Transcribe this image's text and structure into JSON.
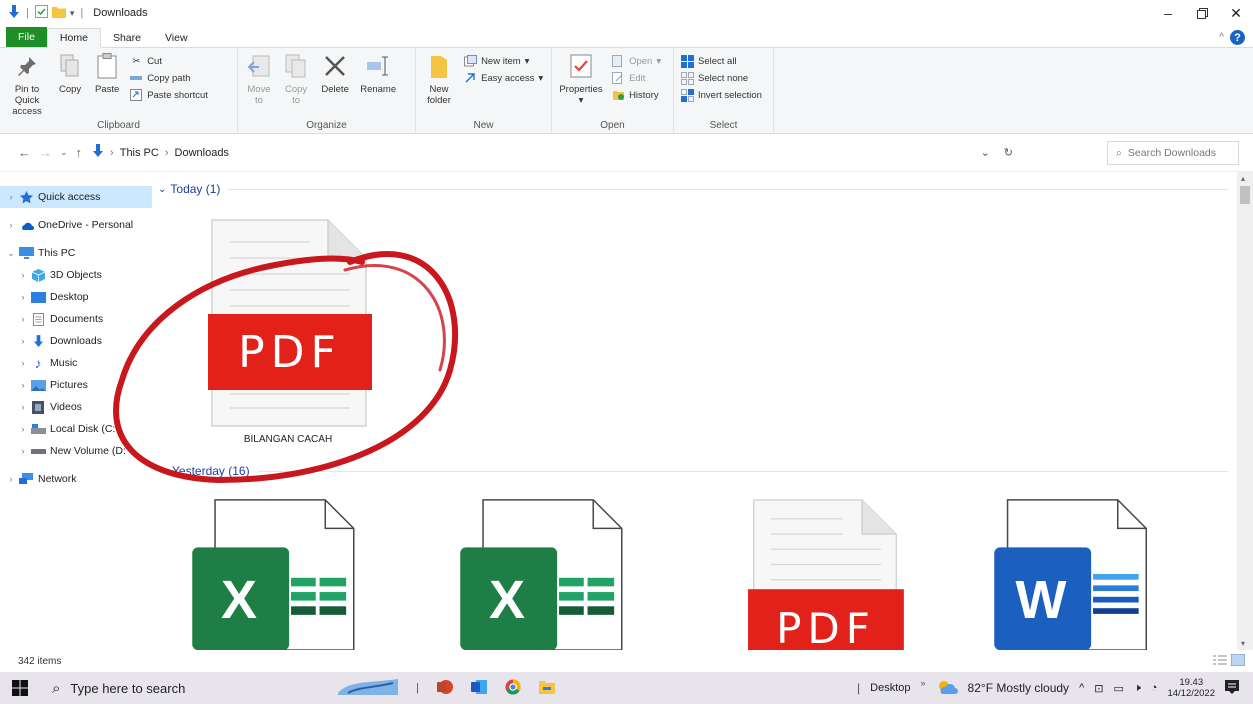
{
  "titlebar": {
    "title": "Downloads",
    "controls": [
      "minimize",
      "restore",
      "close"
    ]
  },
  "tabs": [
    {
      "label": "File"
    },
    {
      "label": "Home"
    },
    {
      "label": "Share"
    },
    {
      "label": "View"
    }
  ],
  "ribbon": {
    "clipboard": {
      "label": "Clipboard",
      "pin_label": "Pin to Quick access",
      "copy_label": "Copy",
      "paste_label": "Paste",
      "cut_label": "Cut",
      "copy_path_label": "Copy path",
      "paste_shortcut_label": "Paste shortcut"
    },
    "organize": {
      "label": "Organize",
      "move_to_label": "Move to",
      "copy_to_label": "Copy to",
      "delete_label": "Delete",
      "rename_label": "Rename"
    },
    "new": {
      "label": "New",
      "new_folder_label": "New folder",
      "new_item_label": "New item",
      "easy_access_label": "Easy access"
    },
    "open": {
      "label": "Open",
      "properties_label": "Properties",
      "open_label": "Open",
      "edit_label": "Edit",
      "history_label": "History"
    },
    "select": {
      "label": "Select",
      "select_all_label": "Select all",
      "select_none_label": "Select none",
      "invert_label": "Invert selection"
    }
  },
  "address": {
    "crumbs": [
      "This PC",
      "Downloads"
    ],
    "search_placeholder": "Search Downloads"
  },
  "nav": {
    "items": [
      {
        "label": "Quick access",
        "icon": "star-icon",
        "chev": "›"
      },
      {
        "label": "OneDrive - Personal",
        "icon": "cloud-icon",
        "chev": "›"
      },
      {
        "label": "This PC",
        "icon": "monitor-icon",
        "chev": "⌄"
      },
      {
        "label": "3D Objects",
        "icon": "cube-icon",
        "chev": "›"
      },
      {
        "label": "Desktop",
        "icon": "desktop-icon",
        "chev": "›"
      },
      {
        "label": "Documents",
        "icon": "document-icon",
        "chev": "›"
      },
      {
        "label": "Downloads",
        "icon": "download-icon",
        "chev": "›"
      },
      {
        "label": "Music",
        "icon": "music-icon",
        "chev": "›"
      },
      {
        "label": "Pictures",
        "icon": "pictures-icon",
        "chev": "›"
      },
      {
        "label": "Videos",
        "icon": "video-icon",
        "chev": "›"
      },
      {
        "label": "Local Disk (C:",
        "icon": "disk-icon",
        "chev": "›"
      },
      {
        "label": "New Volume (D:",
        "icon": "drive-icon",
        "chev": "›"
      },
      {
        "label": "Network",
        "icon": "network-icon",
        "chev": "›"
      }
    ]
  },
  "content": {
    "today_label": "Today (1)",
    "yesterday_label": "Yesterday (16)",
    "today_files": [
      {
        "name": "BILANGAN CACAH",
        "type": "pdf",
        "badge": "PDF"
      }
    ],
    "yesterday_files": [
      {
        "type": "excel",
        "badge": "X"
      },
      {
        "type": "excel",
        "badge": "X"
      },
      {
        "type": "pdf",
        "badge": "PDF"
      },
      {
        "type": "word",
        "badge": "W"
      }
    ]
  },
  "status": {
    "item_count": "342 items"
  },
  "taskbar": {
    "search_placeholder": "Type here to search",
    "desktop_label": "Desktop",
    "weather": "82°F  Mostly cloudy",
    "time": "19.43",
    "date": "14/12/2022"
  },
  "colors": {
    "pdf_red": "#e1211a",
    "excel_green": "#1e7e45",
    "word_blue": "#1b5fbf",
    "accent_blue": "#1e3f9e",
    "annotation_red": "#c8171d"
  }
}
